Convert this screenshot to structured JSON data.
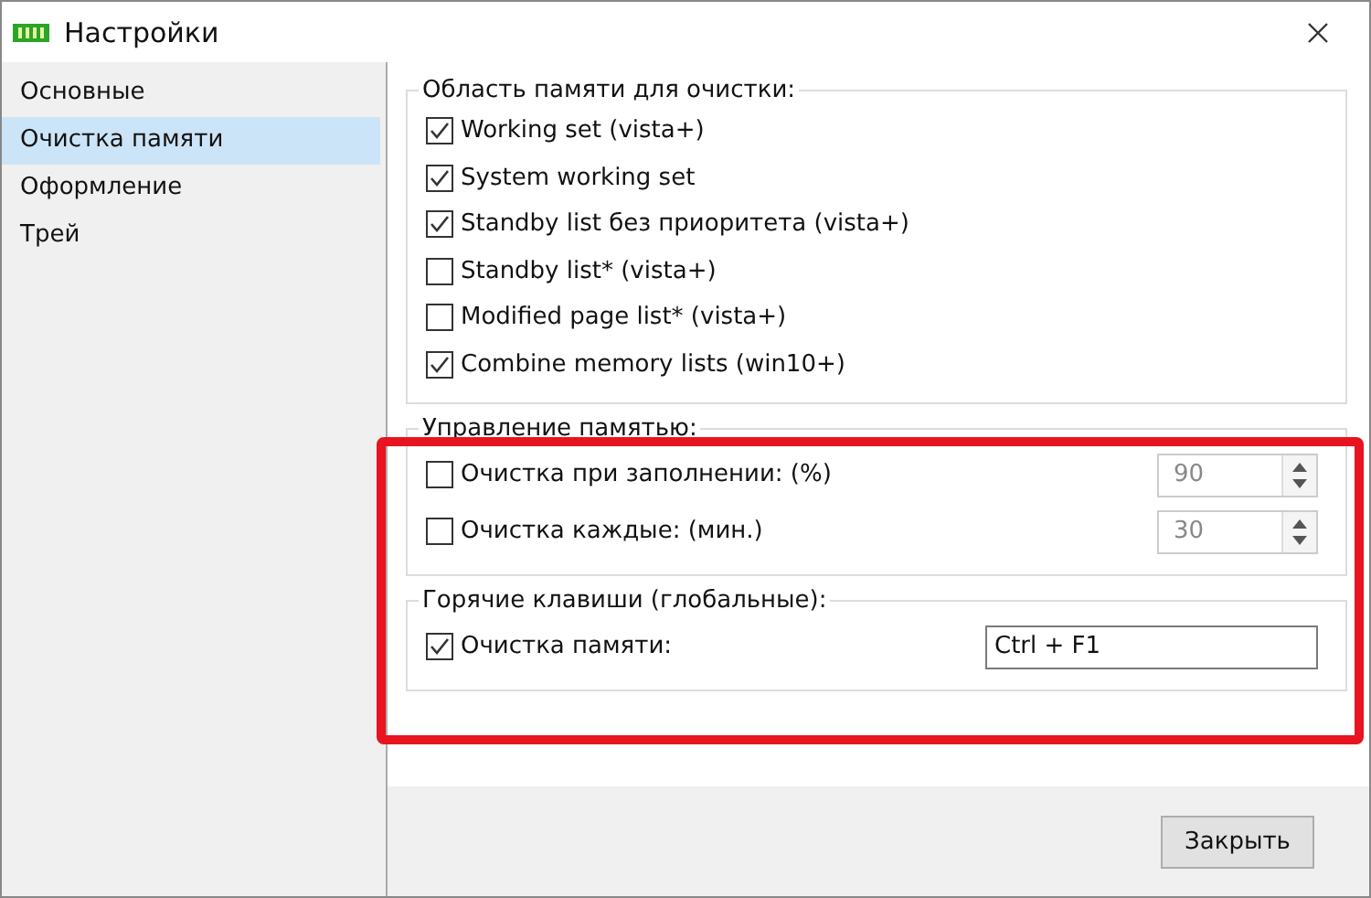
{
  "window": {
    "title": "Настройки"
  },
  "sidebar": {
    "items": [
      {
        "label": "Основные",
        "selected": false
      },
      {
        "label": "Очистка памяти",
        "selected": true
      },
      {
        "label": "Оформление",
        "selected": false
      },
      {
        "label": "Трей",
        "selected": false
      }
    ]
  },
  "groups": [
    {
      "title": "Область памяти для очистки:",
      "rows": [
        {
          "kind": "checkbox",
          "label": "Working set (vista+)",
          "checked": true
        },
        {
          "kind": "checkbox",
          "label": "System working set",
          "checked": true
        },
        {
          "kind": "checkbox",
          "label": "Standby list без приоритета (vista+)",
          "checked": true
        },
        {
          "kind": "checkbox",
          "label": "Standby list* (vista+)",
          "checked": false
        },
        {
          "kind": "checkbox",
          "label": "Modified page list* (vista+)",
          "checked": false
        },
        {
          "kind": "checkbox",
          "label": "Combine memory lists (win10+)",
          "checked": true
        }
      ]
    },
    {
      "title": "Управление памятью:",
      "rows": [
        {
          "kind": "spinner",
          "label": "Очистка при заполнении: (%)",
          "checked": false,
          "value": "90",
          "disabled": true
        },
        {
          "kind": "spinner",
          "label": "Очистка каждые: (мин.)",
          "checked": false,
          "value": "30",
          "disabled": true
        }
      ]
    },
    {
      "title": "Горячие клавиши (глобальные):",
      "rows": [
        {
          "kind": "hotkey",
          "label": "Очистка памяти:",
          "checked": true,
          "value": "Ctrl + F1"
        }
      ]
    }
  ],
  "buttons": [
    {
      "label": "Закрыть"
    }
  ]
}
